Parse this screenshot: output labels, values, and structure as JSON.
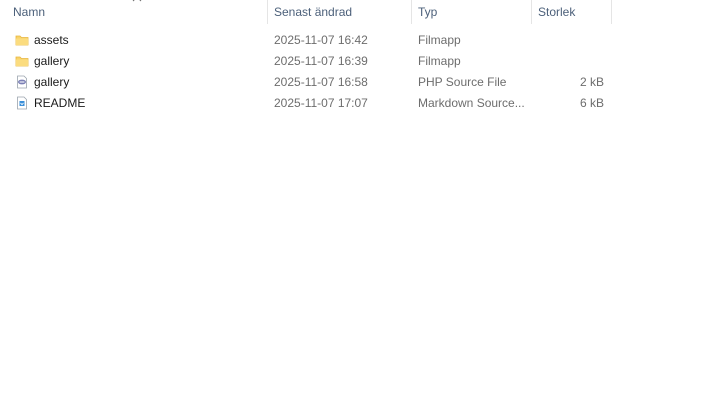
{
  "columns": {
    "name": "Namn",
    "date": "Senast ändrad",
    "type": "Typ",
    "size": "Storlek"
  },
  "sort": {
    "column": "name",
    "icon": "chevron-up-icon"
  },
  "rows": [
    {
      "name": "assets",
      "date": "2025-11-07 16:42",
      "type": "Filmapp",
      "size": "",
      "icon": "folder-icon"
    },
    {
      "name": "gallery",
      "date": "2025-11-07 16:39",
      "type": "Filmapp",
      "size": "",
      "icon": "folder-icon"
    },
    {
      "name": "gallery",
      "date": "2025-11-07 16:58",
      "type": "PHP Source File",
      "size": "2 kB",
      "icon": "php-file-icon"
    },
    {
      "name": "README",
      "date": "2025-11-07 17:07",
      "type": "Markdown Source...",
      "size": "6 kB",
      "icon": "markdown-file-icon"
    }
  ],
  "colors": {
    "header_text": "#4c607a",
    "folder": "#f8d36a",
    "folder_dark": "#e8b63f",
    "secondary_text": "#6d6d6d"
  }
}
